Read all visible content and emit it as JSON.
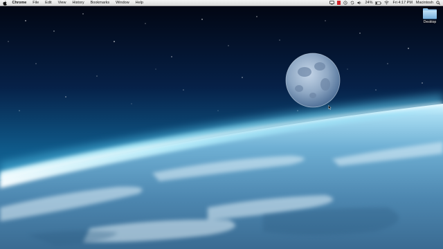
{
  "menubar": {
    "apple_icon": "apple-logo-icon",
    "app_name": "Chrome",
    "menus": [
      "File",
      "Edit",
      "View",
      "History",
      "Bookmarks",
      "Window",
      "Help"
    ],
    "status_icons": [
      "screen-mirroring-icon",
      "red-status-icon",
      "time-machine-icon",
      "sync-icon",
      "volume-icon"
    ],
    "battery_percent": "24%",
    "wifi_icon": "wifi-icon",
    "clock": "Fri 4:17 PM",
    "user_name": "Macintosh"
  },
  "desktop": {
    "icons": [
      {
        "label": "Desktop",
        "icon": "folder-icon"
      }
    ],
    "wallpaper": "earth-from-space-with-moon"
  },
  "colors": {
    "menubar_bg": "#e6e6e6",
    "folder_blue": "#8fc3ea",
    "space_dark": "#020a1e",
    "atmosphere_glow": "#cdf6ff"
  }
}
